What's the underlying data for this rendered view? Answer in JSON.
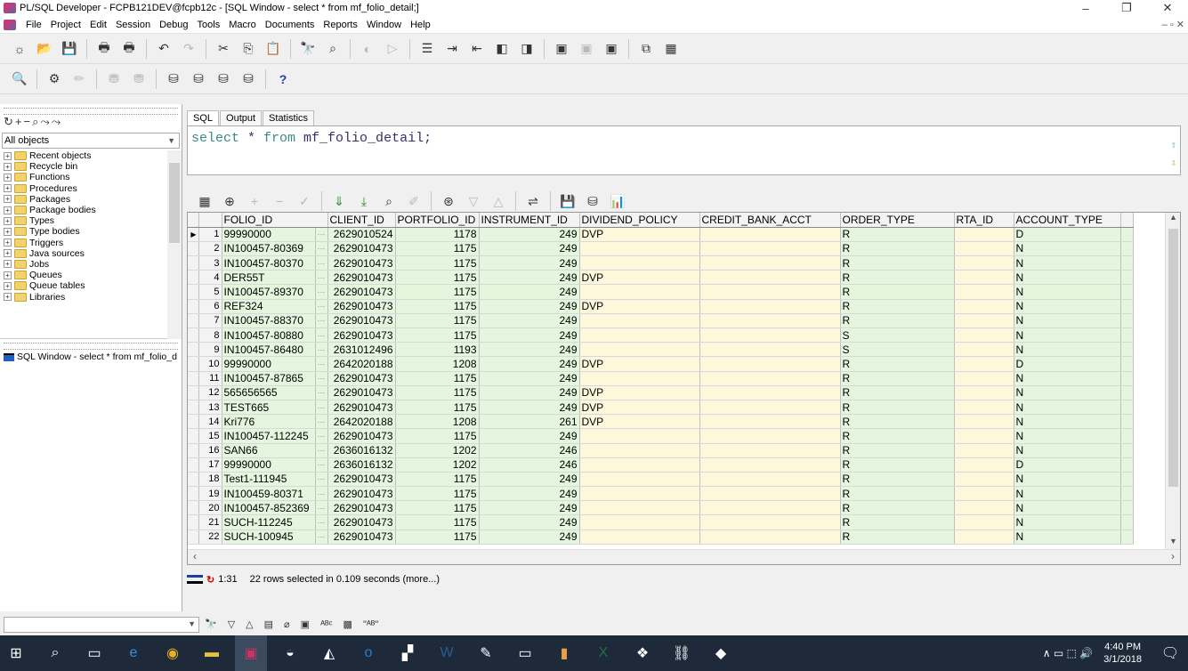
{
  "window": {
    "title": "PL/SQL Developer - FCPB121DEV@fcpb12c - [SQL Window - select * from mf_folio_detail;]",
    "minimize": "–",
    "maximize": "❐",
    "close": "✕"
  },
  "menu": [
    "File",
    "Project",
    "Edit",
    "Session",
    "Debug",
    "Tools",
    "Macro",
    "Documents",
    "Reports",
    "Window",
    "Help"
  ],
  "mdi_controls": "– ▫ ✕",
  "left_panel": {
    "object_filter": "All objects",
    "tree_items": [
      "Recent objects",
      "Recycle bin",
      "Functions",
      "Procedures",
      "Packages",
      "Package bodies",
      "Types",
      "Type bodies",
      "Triggers",
      "Java sources",
      "Jobs",
      "Queues",
      "Queue tables",
      "Libraries"
    ],
    "window_list": [
      "SQL Window - select * from mf_folio_d"
    ]
  },
  "tabs": [
    "SQL",
    "Output",
    "Statistics"
  ],
  "editor": {
    "kw_select": "select",
    "star": " * ",
    "kw_from": "from",
    "table": " mf_folio_detail;"
  },
  "grid": {
    "columns": [
      "FOLIO_ID",
      "CLIENT_ID",
      "PORTFOLIO_ID",
      "INSTRUMENT_ID",
      "DIVIDEND_POLICY",
      "CREDIT_BANK_ACCT",
      "ORDER_TYPE",
      "RTA_ID",
      "ACCOUNT_TYPE"
    ],
    "rows": [
      [
        "1",
        "99990000",
        "2629010524",
        "1178",
        "249",
        "DVP",
        "",
        "R",
        "",
        "D"
      ],
      [
        "2",
        "IN100457-80369",
        "2629010473",
        "1175",
        "249",
        "",
        "",
        "R",
        "",
        "N"
      ],
      [
        "3",
        "IN100457-80370",
        "2629010473",
        "1175",
        "249",
        "",
        "",
        "R",
        "",
        "N"
      ],
      [
        "4",
        "DER55T",
        "2629010473",
        "1175",
        "249",
        "DVP",
        "",
        "R",
        "",
        "N"
      ],
      [
        "5",
        "IN100457-89370",
        "2629010473",
        "1175",
        "249",
        "",
        "",
        "R",
        "",
        "N"
      ],
      [
        "6",
        "REF324",
        "2629010473",
        "1175",
        "249",
        "DVP",
        "",
        "R",
        "",
        "N"
      ],
      [
        "7",
        "IN100457-88370",
        "2629010473",
        "1175",
        "249",
        "",
        "",
        "R",
        "",
        "N"
      ],
      [
        "8",
        "IN100457-80880",
        "2629010473",
        "1175",
        "249",
        "",
        "",
        "S",
        "",
        "N"
      ],
      [
        "9",
        "IN100457-86480",
        "2631012496",
        "1193",
        "249",
        "",
        "",
        "S",
        "",
        "N"
      ],
      [
        "10",
        "99990000",
        "2642020188",
        "1208",
        "249",
        "DVP",
        "",
        "R",
        "",
        "D"
      ],
      [
        "11",
        "IN100457-87865",
        "2629010473",
        "1175",
        "249",
        "",
        "",
        "R",
        "",
        "N"
      ],
      [
        "12",
        "565656565",
        "2629010473",
        "1175",
        "249",
        "DVP",
        "",
        "R",
        "",
        "N"
      ],
      [
        "13",
        "TEST665",
        "2629010473",
        "1175",
        "249",
        "DVP",
        "",
        "R",
        "",
        "N"
      ],
      [
        "14",
        "Kri776",
        "2642020188",
        "1208",
        "261",
        "DVP",
        "",
        "R",
        "",
        "N"
      ],
      [
        "15",
        "IN100457-112245",
        "2629010473",
        "1175",
        "249",
        "",
        "",
        "R",
        "",
        "N"
      ],
      [
        "16",
        "SAN66",
        "2636016132",
        "1202",
        "246",
        "",
        "",
        "R",
        "",
        "N"
      ],
      [
        "17",
        "99990000",
        "2636016132",
        "1202",
        "246",
        "",
        "",
        "R",
        "",
        "D"
      ],
      [
        "18",
        "Test1-111945",
        "2629010473",
        "1175",
        "249",
        "",
        "",
        "R",
        "",
        "N"
      ],
      [
        "19",
        "IN100459-80371",
        "2629010473",
        "1175",
        "249",
        "",
        "",
        "R",
        "",
        "N"
      ],
      [
        "20",
        "IN100457-852369",
        "2629010473",
        "1175",
        "249",
        "",
        "",
        "R",
        "",
        "N"
      ],
      [
        "21",
        "SUCH-112245",
        "2629010473",
        "1175",
        "249",
        "",
        "",
        "R",
        "",
        "N"
      ],
      [
        "22",
        "SUCH-100945",
        "2629010473",
        "1175",
        "249",
        "",
        "",
        "R",
        "",
        "N"
      ]
    ]
  },
  "status": {
    "position": "1:31",
    "message": "22 rows selected in 0.109 seconds (more...)"
  },
  "taskbar": {
    "time": "4:40 PM",
    "date": "3/1/2018"
  }
}
